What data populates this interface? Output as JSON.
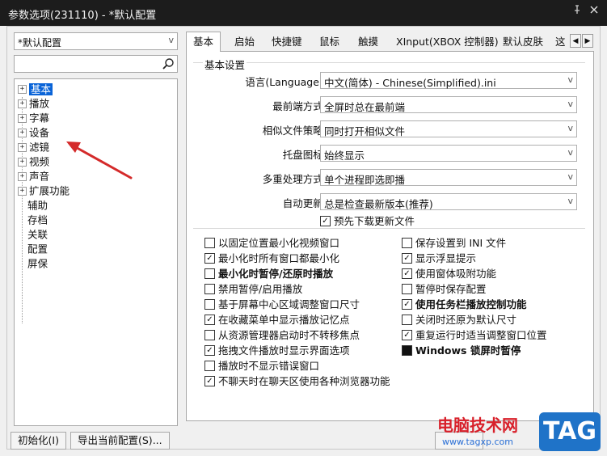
{
  "window": {
    "title": "参数选项(231110) - *默认配置",
    "pin_icon": "pin-icon",
    "close_icon": "close-icon"
  },
  "sidebar": {
    "profile_select": "*默认配置",
    "search_placeholder": "",
    "tree": [
      {
        "label": "基本",
        "expandable": true,
        "selected": true
      },
      {
        "label": "播放",
        "expandable": true
      },
      {
        "label": "字幕",
        "expandable": true
      },
      {
        "label": "设备",
        "expandable": true
      },
      {
        "label": "滤镜",
        "expandable": true
      },
      {
        "label": "视频",
        "expandable": true
      },
      {
        "label": "声音",
        "expandable": true
      },
      {
        "label": "扩展功能",
        "expandable": true
      },
      {
        "label": "辅助",
        "expandable": false
      },
      {
        "label": "存档",
        "expandable": false
      },
      {
        "label": "关联",
        "expandable": false
      },
      {
        "label": "配置",
        "expandable": false
      },
      {
        "label": "屏保",
        "expandable": false
      }
    ]
  },
  "tabs": [
    "基本",
    "启始",
    "快捷键",
    "鼠标",
    "触摸",
    "XInput(XBOX 控制器)",
    "默认皮肤",
    "这"
  ],
  "active_tab": "基本",
  "basic": {
    "group_title": "基本设置",
    "settings": [
      {
        "label": "语言(Language):",
        "value": "中文(简体) - Chinese(Simplified).ini"
      },
      {
        "label": "最前端方式:",
        "value": "全屏时总在最前端"
      },
      {
        "label": "相似文件策略:",
        "value": "同时打开相似文件"
      },
      {
        "label": "托盘图标:",
        "value": "始终显示"
      },
      {
        "label": "多重处理方式:",
        "value": "单个进程即选即播"
      },
      {
        "label": "自动更新:",
        "value": "总是检查最新版本(推荐)"
      }
    ],
    "predownload": {
      "label": "预先下载更新文件",
      "checked": true
    }
  },
  "options_left": [
    {
      "label": "以固定位置最小化视频窗口",
      "checked": false,
      "bold": false
    },
    {
      "label": "最小化时所有窗口都最小化",
      "checked": true,
      "bold": false
    },
    {
      "label": "最小化时暂停/还原时播放",
      "checked": false,
      "bold": true
    },
    {
      "label": "禁用暂停/启用播放",
      "checked": false,
      "bold": false
    },
    {
      "label": "基于屏幕中心区域调整窗口尺寸",
      "checked": false,
      "bold": false
    },
    {
      "label": "在收藏菜单中显示播放记忆点",
      "checked": true,
      "bold": false
    },
    {
      "label": "从资源管理器启动时不转移焦点",
      "checked": false,
      "bold": false
    },
    {
      "label": "拖拽文件播放时显示界面选项",
      "checked": true,
      "bold": false
    },
    {
      "label": "播放时不显示错误窗口",
      "checked": false,
      "bold": false
    },
    {
      "label": "不聊天时在聊天区使用各种浏览器功能",
      "checked": true,
      "bold": false
    }
  ],
  "options_right": [
    {
      "label": "保存设置到 INI 文件",
      "checked": false,
      "bold": false
    },
    {
      "label": "显示浮显提示",
      "checked": true,
      "bold": false
    },
    {
      "label": "使用窗体吸附功能",
      "checked": true,
      "bold": false
    },
    {
      "label": "暂停时保存配置",
      "checked": false,
      "bold": false
    },
    {
      "label": "使用任务栏播放控制功能",
      "checked": true,
      "bold": true
    },
    {
      "label": "关闭时还原为默认尺寸",
      "checked": false,
      "bold": false
    },
    {
      "label": "重复运行时适当调整窗口位置",
      "checked": true,
      "bold": false
    },
    {
      "label": "Windows 锁屏时暂停",
      "checked": "indeterminate",
      "bold": true
    }
  ],
  "footer": {
    "init_button": "初始化(I)",
    "export_button": "导出当前配置(S)..."
  },
  "watermark": {
    "site_name": "电脑技术网",
    "url": "www.tagxp.com",
    "tag": "TAG"
  },
  "colors": {
    "titlebar": "#1c1c1c",
    "selection": "#0a64d8",
    "annotation_arrow": "#d42a2a"
  }
}
